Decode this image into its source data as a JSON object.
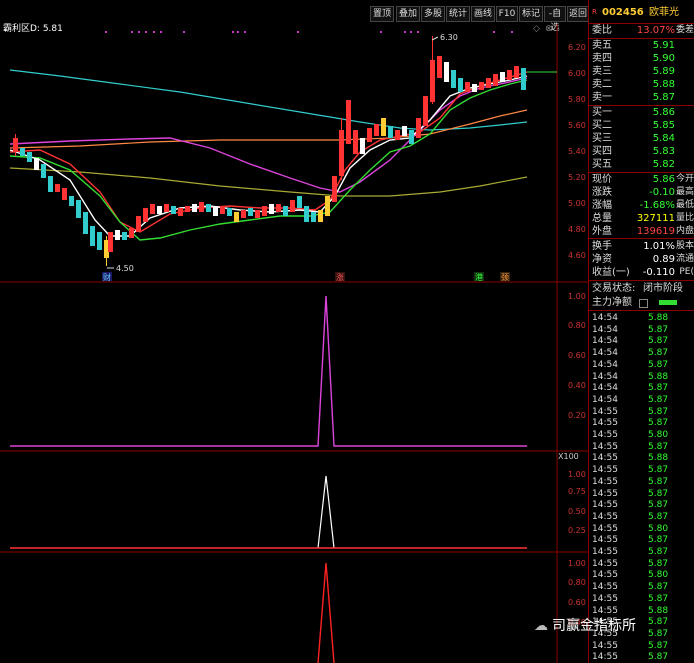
{
  "toolbar": {
    "buttons": [
      "置顶",
      "叠加",
      "多股",
      "统计",
      "画线",
      "F10",
      "标记",
      "-自选",
      "返回"
    ],
    "title": "霸利区D: 5.81"
  },
  "main_chart": {
    "y_ticks": [
      "6.20",
      "6.00",
      "5.80",
      "5.60",
      "5.40",
      "5.20",
      "5.00",
      "4.80",
      "4.60"
    ],
    "high_label": "6.30",
    "low_label": "4.50",
    "markers": [
      "财",
      "涨",
      "港",
      "颈"
    ]
  },
  "sub1": {
    "y_ticks": [
      "1.00",
      "0.80",
      "0.60",
      "0.40",
      "0.20"
    ]
  },
  "sub2": {
    "header": "X100",
    "y_ticks": [
      "1.00",
      "0.75",
      "0.50",
      "0.25"
    ]
  },
  "sub3": {
    "y_ticks": [
      "1.00",
      "0.80",
      "0.60",
      "0.40"
    ]
  },
  "panel": {
    "code": "002456",
    "name": "欧菲光",
    "weibi_label": "委比",
    "weibi_value": "13.07%",
    "weibi_ext": "委差",
    "asks": [
      {
        "label": "卖五",
        "price": "5.91"
      },
      {
        "label": "卖四",
        "price": "5.90"
      },
      {
        "label": "卖三",
        "price": "5.89"
      },
      {
        "label": "卖二",
        "price": "5.88"
      },
      {
        "label": "卖一",
        "price": "5.87"
      }
    ],
    "bids": [
      {
        "label": "买一",
        "price": "5.86"
      },
      {
        "label": "买二",
        "price": "5.85"
      },
      {
        "label": "买三",
        "price": "5.84"
      },
      {
        "label": "买四",
        "price": "5.83"
      },
      {
        "label": "买五",
        "price": "5.82"
      }
    ],
    "stats": [
      {
        "label": "现价",
        "value": "5.86",
        "ext": "今开",
        "color": "#33ff33"
      },
      {
        "label": "涨跌",
        "value": "-0.10",
        "ext": "最高",
        "color": "#33ff33"
      },
      {
        "label": "涨幅",
        "value": "-1.68%",
        "ext": "最低",
        "color": "#33ff33"
      },
      {
        "label": "总量",
        "value": "327111",
        "ext": "量比",
        "color": "#ffff00"
      },
      {
        "label": "外盘",
        "value": "139619",
        "ext": "内盘",
        "color": "#ff4444"
      }
    ],
    "extra": [
      {
        "label": "换手",
        "value": "1.01%",
        "ext": "股本",
        "color": "#ffffff"
      },
      {
        "label": "净资",
        "value": "0.89",
        "ext": "流通",
        "color": "#ffffff"
      },
      {
        "label": "收益(一)",
        "value": "-0.110",
        "ext": "PE(",
        "color": "#ffffff"
      }
    ],
    "status_label": "交易状态:",
    "status_value": "闭市阶段",
    "main_net_label": "主力净额",
    "ticks": [
      {
        "time": "14:54",
        "price": "5.88"
      },
      {
        "time": "14:54",
        "price": "5.87"
      },
      {
        "time": "14:54",
        "price": "5.87"
      },
      {
        "time": "14:54",
        "price": "5.87"
      },
      {
        "time": "14:54",
        "price": "5.87"
      },
      {
        "time": "14:54",
        "price": "5.88"
      },
      {
        "time": "14:54",
        "price": "5.87"
      },
      {
        "time": "14:54",
        "price": "5.87"
      },
      {
        "time": "14:55",
        "price": "5.87"
      },
      {
        "time": "14:55",
        "price": "5.87"
      },
      {
        "time": "14:55",
        "price": "5.80"
      },
      {
        "time": "14:55",
        "price": "5.87"
      },
      {
        "time": "14:55",
        "price": "5.88"
      },
      {
        "time": "14:55",
        "price": "5.87"
      },
      {
        "time": "14:55",
        "price": "5.87"
      },
      {
        "time": "14:55",
        "price": "5.87"
      },
      {
        "time": "14:55",
        "price": "5.87"
      },
      {
        "time": "14:55",
        "price": "5.87"
      },
      {
        "time": "14:55",
        "price": "5.80"
      },
      {
        "time": "14:55",
        "price": "5.87"
      },
      {
        "time": "14:55",
        "price": "5.87"
      },
      {
        "time": "14:55",
        "price": "5.87"
      },
      {
        "time": "14:55",
        "price": "5.80"
      },
      {
        "time": "14:55",
        "price": "5.87"
      },
      {
        "time": "14:55",
        "price": "5.87"
      },
      {
        "time": "14:55",
        "price": "5.88"
      },
      {
        "time": "14:55",
        "price": "5.87"
      },
      {
        "time": "14:55",
        "price": "5.87"
      },
      {
        "time": "14:55",
        "price": "5.87"
      },
      {
        "time": "14:55",
        "price": "5.87"
      }
    ]
  },
  "watermark": "司赢金指标所"
}
